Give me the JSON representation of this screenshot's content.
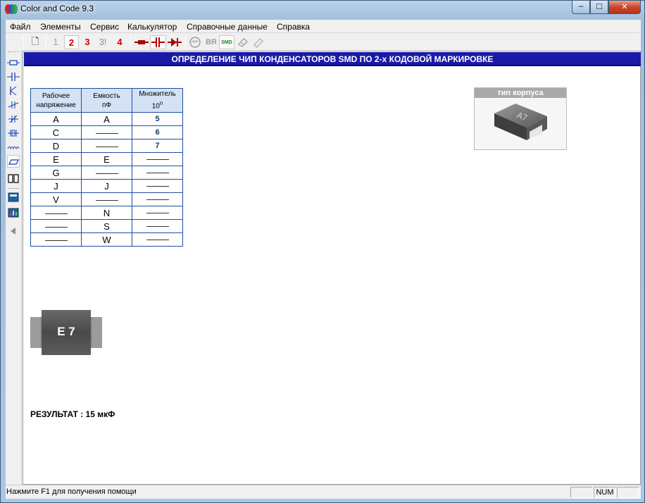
{
  "window": {
    "title": "Color and Code 9.3",
    "min_glyph": "─",
    "max_glyph": "☐",
    "close_glyph": "✕"
  },
  "menu": [
    "Файл",
    "Элементы",
    "Сервис",
    "Калькулятор",
    "Справочные данные",
    "Справка"
  ],
  "toolbar": {
    "new_doc_glyph": "🗋",
    "band1": "1",
    "band2": "2",
    "band3": "3",
    "band3_excl": "3!",
    "band4": "4",
    "br_label": "BR",
    "smd_label": "SMD"
  },
  "banner": "ОПРЕДЕЛЕНИЕ ЧИП КОНДЕНСАТОРОВ SMD ПО 2-х КОДОВОЙ МАРКИРОВКЕ",
  "table": {
    "headers": {
      "voltage_line1": "Рабочее",
      "voltage_line2": "напряжение",
      "capacity_line1": "Емкость",
      "capacity_line2": "пФ",
      "mult_line1": "Множитель",
      "mult_base": "10",
      "mult_exp": "n"
    },
    "rows": [
      {
        "voltage": "A",
        "capacity": "A",
        "mult": "5"
      },
      {
        "voltage": "C",
        "capacity": "",
        "mult": "6"
      },
      {
        "voltage": "D",
        "capacity": "",
        "mult": "7"
      },
      {
        "voltage": "E",
        "capacity": "E",
        "mult": ""
      },
      {
        "voltage": "G",
        "capacity": "",
        "mult": ""
      },
      {
        "voltage": "J",
        "capacity": "J",
        "mult": ""
      },
      {
        "voltage": "V",
        "capacity": "",
        "mult": ""
      },
      {
        "voltage": "",
        "capacity": "N",
        "mult": ""
      },
      {
        "voltage": "",
        "capacity": "S",
        "mult": ""
      },
      {
        "voltage": "",
        "capacity": "W",
        "mult": ""
      }
    ]
  },
  "package": {
    "title": "тип корпуса",
    "marking": "A7"
  },
  "chip": {
    "marking": "E 7"
  },
  "result": "РЕЗУЛЬТАТ : 15 мкФ",
  "statusbar": {
    "help_text": "Нажмите F1 для получения помощи",
    "num": "NUM"
  },
  "colors": {
    "banner_bg": "#1a1aa8",
    "table_border": "#1f4ea0",
    "table_header_bg": "#d4e2f6",
    "band_red": "#d00000"
  }
}
